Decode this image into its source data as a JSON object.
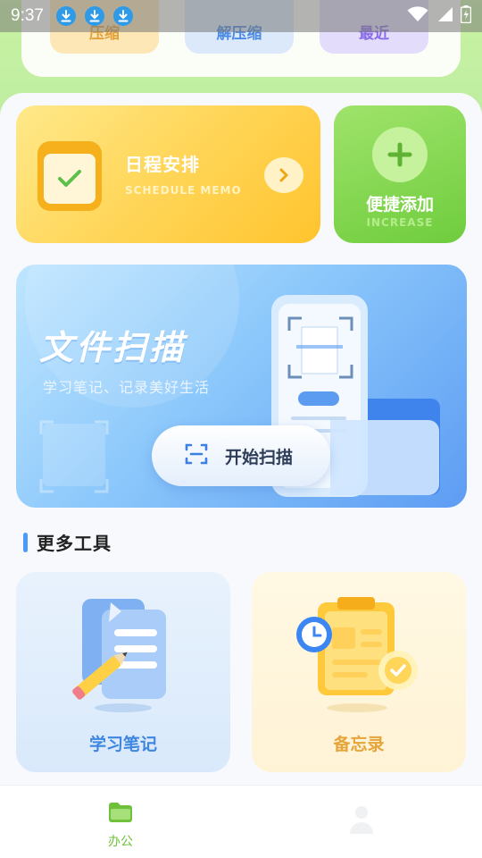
{
  "status_bar": {
    "time": "9:37",
    "download_icons": [
      "download-icon",
      "download-icon",
      "download-icon"
    ],
    "icons": [
      "wifi-icon",
      "signal-icon",
      "battery-icon"
    ]
  },
  "top_tools": {
    "compress": "压缩",
    "decompress": "解压缩",
    "recent": "最近"
  },
  "schedule": {
    "title": "日程安排",
    "subtitle": "SCHEDULE MEMO",
    "accent": "#ffc42e"
  },
  "quick_add": {
    "title": "便捷添加",
    "subtitle": "INCREASE",
    "accent": "#6fcd3d"
  },
  "scan": {
    "title": "文件扫描",
    "subtitle": "学习笔记、记录美好生活",
    "button_label": "开始扫描",
    "accent": "#5d9cf3"
  },
  "more_tools": {
    "heading": "更多工具",
    "items": [
      {
        "label": "学习笔记",
        "icon": "notes-icon"
      },
      {
        "label": "备忘录",
        "icon": "memo-icon"
      }
    ]
  },
  "bottom_nav": {
    "items": [
      {
        "label": "办公",
        "icon": "folder-icon",
        "active": true
      },
      {
        "label": "",
        "icon": "user-icon",
        "active": false
      }
    ],
    "active_color": "#6fc03a"
  }
}
